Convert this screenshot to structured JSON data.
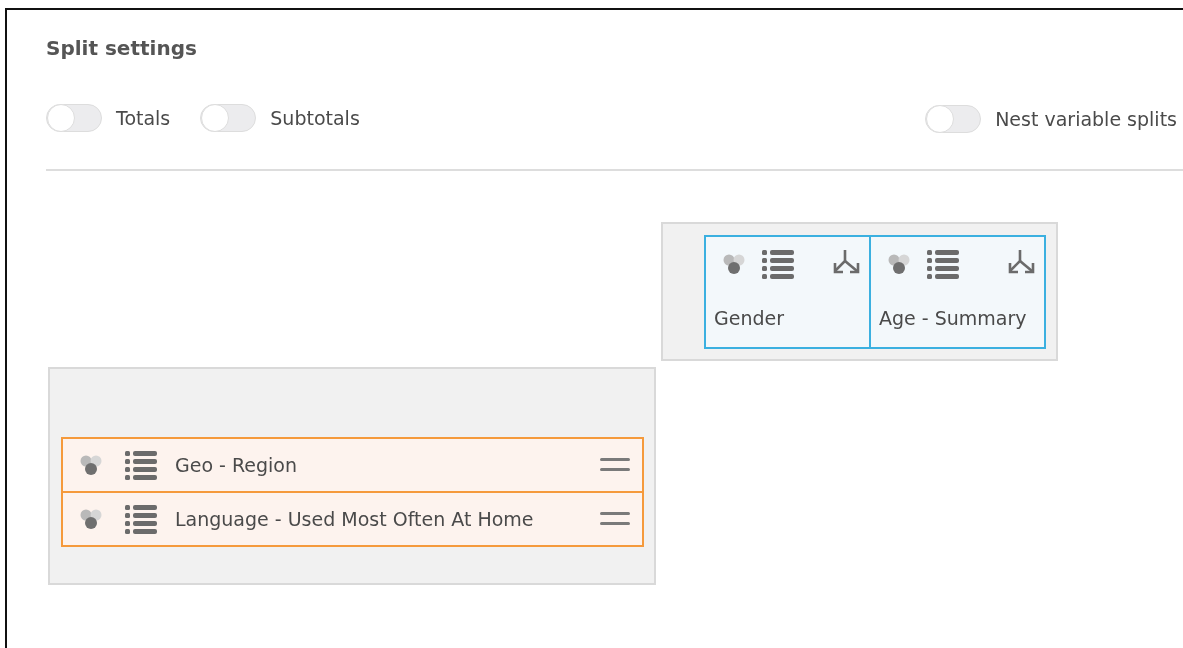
{
  "title": "Split settings",
  "left_toggles": [
    {
      "label": "Totals",
      "on": false
    },
    {
      "label": "Subtotals",
      "on": false
    }
  ],
  "right_toggles": [
    {
      "label": "Nest variable splits",
      "on": false
    }
  ],
  "column_variables": [
    {
      "name": "Gender"
    },
    {
      "name": "Age - Summary"
    }
  ],
  "row_variables": [
    {
      "name": "Geo - Region"
    },
    {
      "name": "Language - Used Most Often At Home"
    }
  ]
}
